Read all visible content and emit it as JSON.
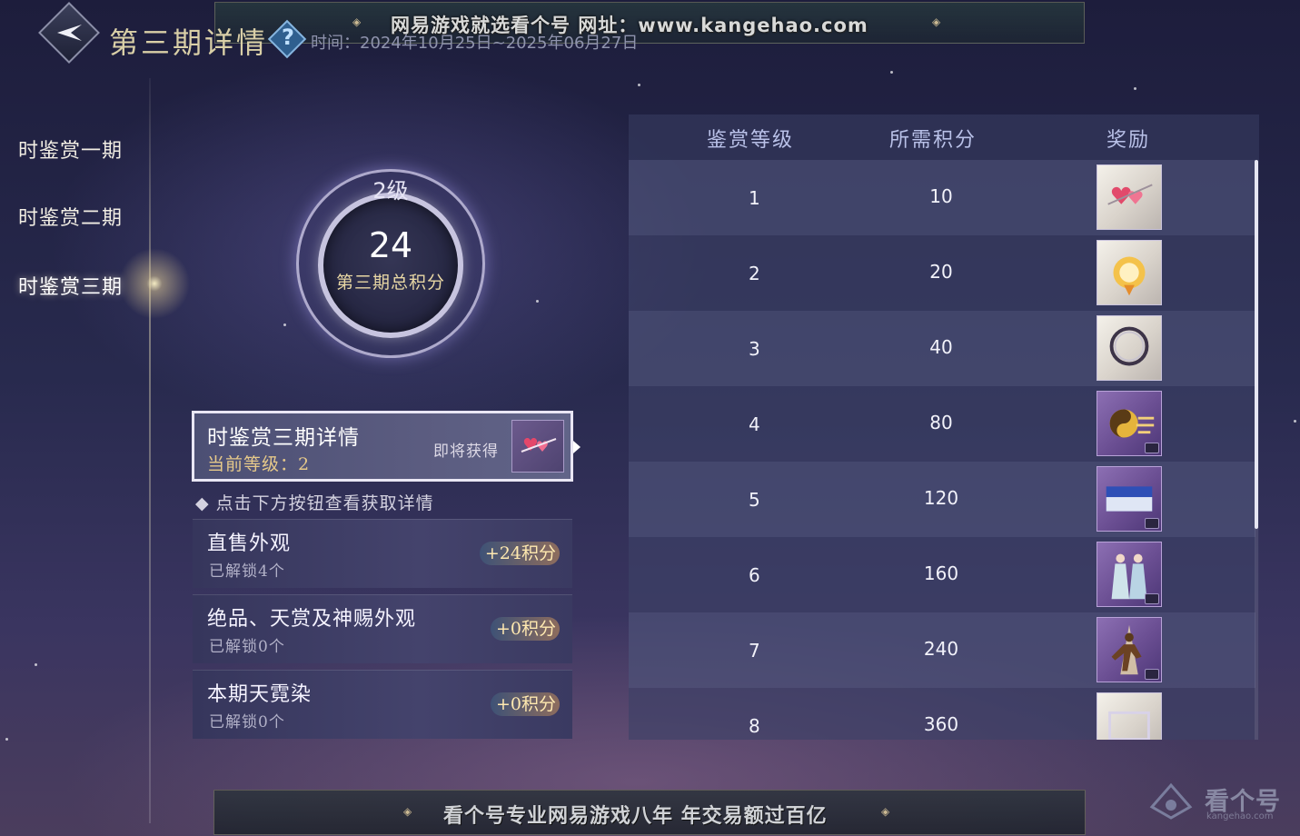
{
  "watermark_top": "网易游戏就选看个号  网址：www.kangehao.com",
  "header": {
    "title": "第三期详情",
    "help_icon": "?",
    "time_label": "时间：2024年10月25日~2025年06月27日"
  },
  "sidebar": {
    "items": [
      {
        "label": "时鉴赏一期"
      },
      {
        "label": "时鉴赏二期"
      },
      {
        "label": "时鉴赏三期"
      }
    ],
    "active_index": 2
  },
  "score": {
    "level": "2级",
    "total": "24",
    "label": "第三期总积分"
  },
  "detail": {
    "title": "时鉴赏三期详情",
    "current_level": "当前等级：2",
    "upcoming_label": "即将获得"
  },
  "hint": "◆ 点击下方按钮查看获取详情",
  "sources": [
    {
      "title": "直售外观",
      "sub": "已解锁4个",
      "points": "+24积分"
    },
    {
      "title": "绝品、天赏及神赐外观",
      "sub": "已解锁0个",
      "points": "+0积分"
    },
    {
      "title": "本期天霓染",
      "sub": "已解锁0个",
      "points": "+0积分"
    }
  ],
  "table": {
    "headers": [
      "鉴赏等级",
      "所需积分",
      "奖励"
    ],
    "rows": [
      {
        "level": "1",
        "points": "10",
        "reward_icon": "heart-arrow-icon"
      },
      {
        "level": "2",
        "points": "20",
        "reward_icon": "title-badge-icon"
      },
      {
        "level": "3",
        "points": "40",
        "reward_icon": "ring-frame-icon"
      },
      {
        "level": "4",
        "points": "80",
        "reward_icon": "taiji-effect-icon"
      },
      {
        "level": "5",
        "points": "120",
        "reward_icon": "sky-card-icon"
      },
      {
        "level": "6",
        "points": "160",
        "reward_icon": "couple-pose-icon"
      },
      {
        "level": "7",
        "points": "240",
        "reward_icon": "dance-action-icon"
      },
      {
        "level": "8",
        "points": "360",
        "reward_icon": "frame-icon"
      }
    ]
  },
  "watermark_bottom": "看个号专业网易游戏八年  年交易额过百亿",
  "watermark_logo": {
    "text": "看个号",
    "sub": "kangehao.com"
  },
  "colors": {
    "accent_gold": "#e6c98a",
    "header_blue": "#b9c1e8",
    "panel": "#52577e"
  }
}
